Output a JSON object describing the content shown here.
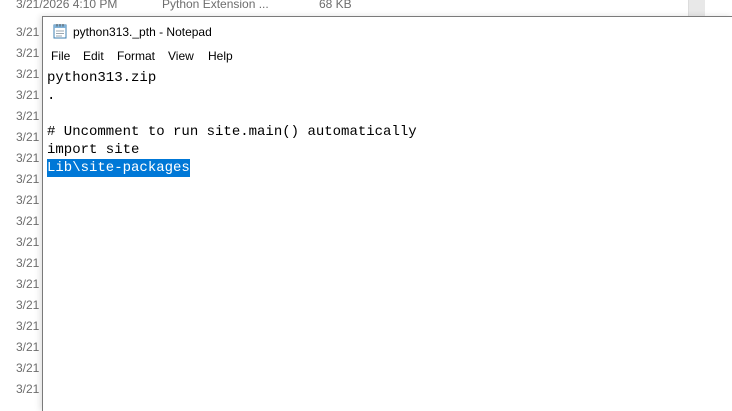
{
  "background_explorer": {
    "top_row": {
      "date": "3/21/2026 4:10 PM",
      "type": "Python Extension ...",
      "size": "68 KB"
    },
    "date_fragment": "3/21"
  },
  "notepad": {
    "title": "python313._pth - Notepad",
    "menu": [
      "File",
      "Edit",
      "Format",
      "View",
      "Help"
    ],
    "lines": [
      "python313.zip",
      ".",
      "",
      "# Uncomment to run site.main() automatically",
      "import site",
      "Lib\\site-packages"
    ],
    "selected_line_index": 5,
    "colors": {
      "selection": "#0078d7",
      "text": "#000000"
    },
    "icon": "notepad-icon"
  }
}
